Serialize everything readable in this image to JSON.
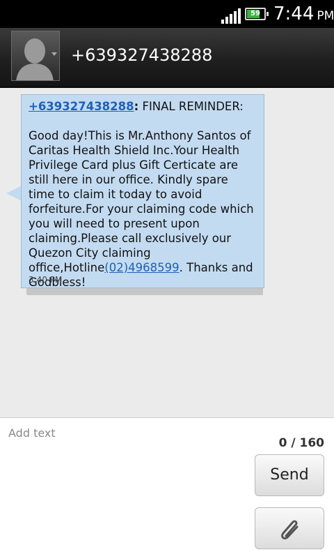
{
  "status_bar": {
    "battery_percent": "59",
    "time": "7:44",
    "ampm": "PM",
    "signal_icon": "signal-bars-icon",
    "battery_icon": "battery-icon",
    "battery_color": "#39b53c"
  },
  "header": {
    "contact_name": "+639327438288",
    "avatar_icon": "person-avatar-icon"
  },
  "message": {
    "sender": "+639327438288",
    "subject_prefix": ":",
    "subject": " FINAL REMINDER:",
    "body_before_link": "Good day!This is Mr.Anthony Santos of Caritas Health Shield Inc.Your Health Privilege Card plus Gift Certicate are still here in our office. Kindly spare time to claim it today to avoid forfeiture.For your claiming code which you will need to present upon claiming.Please call exclusively our Quezon City claiming office,Hotline",
    "phone_link": "(02)4968599",
    "body_after_link": ". Thanks and Godbless!",
    "time": "3:40 PM",
    "bubble_color": "#c3dbf1",
    "link_color": "#1f61b6"
  },
  "compose": {
    "placeholder": "Add text",
    "counter": "0 / 160",
    "send_label": "Send",
    "attach_icon": "paperclip-icon"
  }
}
